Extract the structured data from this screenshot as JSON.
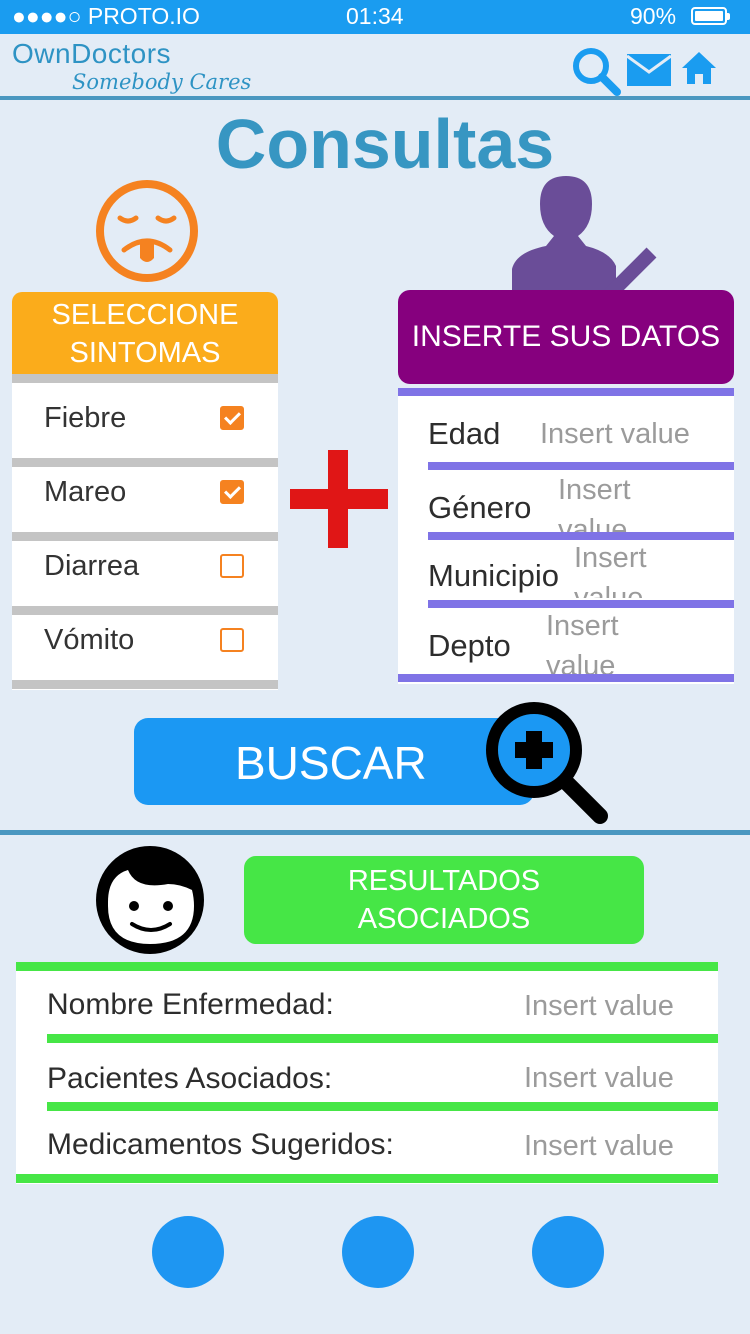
{
  "status_bar": {
    "signal": "●●●●○",
    "carrier": "PROTO.IO",
    "time": "01:34",
    "battery": "90%",
    "battery_level": 0.9
  },
  "header": {
    "brand": "OwnDoctors",
    "tagline": "Somebody Cares",
    "icons": [
      "search-icon",
      "mail-icon",
      "home-icon"
    ]
  },
  "page": {
    "title": "Consultas"
  },
  "symptoms": {
    "heading_line1": "SELECCIONE",
    "heading_line2": "SINTOMAS",
    "items": [
      {
        "label": "Fiebre",
        "checked": true
      },
      {
        "label": "Mareo",
        "checked": true
      },
      {
        "label": "Diarrea",
        "checked": false
      },
      {
        "label": "Vómito",
        "checked": false
      }
    ]
  },
  "user_data": {
    "heading": "INSERTE SUS DATOS",
    "fields": [
      {
        "label": "Edad",
        "placeholder": "Insert value"
      },
      {
        "label": "Género",
        "placeholder": "Insert value"
      },
      {
        "label": "Municipio",
        "placeholder": "Insert value"
      },
      {
        "label": "Depto",
        "placeholder": "Insert value"
      }
    ]
  },
  "search_button": {
    "label": "BUSCAR"
  },
  "results": {
    "heading_line1": "RESULTADOS",
    "heading_line2": "ASOCIADOS",
    "rows": [
      {
        "label": "Nombre Enfermedad:",
        "value": "Insert value"
      },
      {
        "label": "Pacientes Asociados:",
        "value": "Insert value"
      },
      {
        "label": "Medicamentos Sugeridos:",
        "value": "Insert value"
      }
    ]
  },
  "bottom_nav": {
    "count": 3
  },
  "colors": {
    "status_bar": "#1a9cf0",
    "brand": "#2e93c4",
    "symptoms_header": "#fbac1b",
    "checkbox": "#f58220",
    "data_header": "#86007e",
    "data_lines": "#7f73e6",
    "search_button": "#1b98f3",
    "results_header": "#46e646",
    "plus_sign": "#e01616"
  }
}
